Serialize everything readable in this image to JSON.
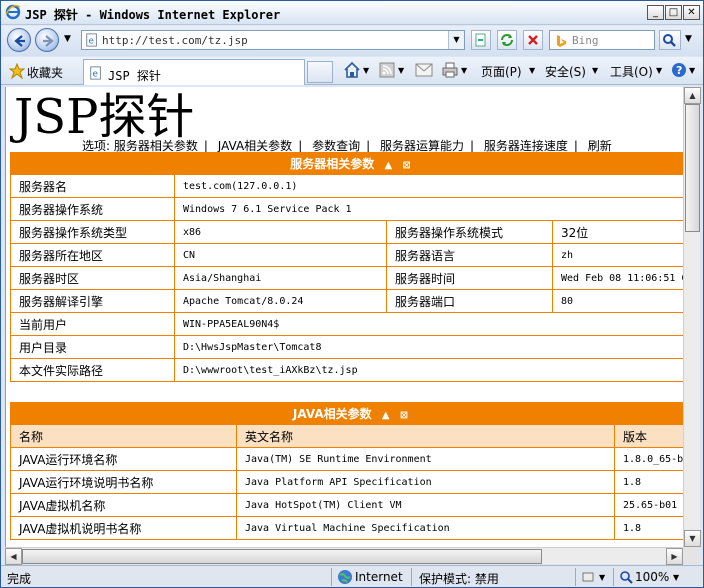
{
  "window": {
    "title": "JSP 探针 - Windows Internet Explorer",
    "minimize": "_",
    "maximize": "□",
    "close": "✕"
  },
  "nav": {
    "address": "http://test.com/tz.jsp",
    "search_placeholder": "Bing"
  },
  "favbar": {
    "favorites": "收藏夹",
    "tab_title": "JSP 探针",
    "page_menu": "页面(P)",
    "safety_menu": "安全(S)",
    "tools_menu": "工具(O)"
  },
  "page": {
    "title": "JSP探针",
    "options_label": "选项:",
    "options": [
      "服务器相关参数",
      "JAVA相关参数",
      "参数查询",
      "服务器运算能力",
      "服务器连接速度",
      "刷新"
    ],
    "server_section": {
      "header": "服务器相关参数",
      "rows": [
        {
          "k1": "服务器名",
          "v1": "test.com(127.0.0.1)"
        },
        {
          "k1": "服务器操作系统",
          "v1": "Windows 7 6.1 Service Pack 1"
        },
        {
          "k1": "服务器操作系统类型",
          "v1": "x86",
          "k2": "服务器操作系统模式",
          "v2": "32位"
        },
        {
          "k1": "服务器所在地区",
          "v1": "CN",
          "k2": "服务器语言",
          "v2": "zh"
        },
        {
          "k1": "服务器时区",
          "v1": "Asia/Shanghai",
          "k2": "服务器时间",
          "v2": "Wed Feb 08 11:06:51 C"
        },
        {
          "k1": "服务器解译引擎",
          "v1": "Apache Tomcat/8.0.24",
          "k2": "服务器端口",
          "v2": "80"
        },
        {
          "k1": "当前用户",
          "v1": "WIN-PPA5EAL90N4$"
        },
        {
          "k1": "用户目录",
          "v1": "D:\\HwsJspMaster\\Tomcat8"
        },
        {
          "k1": "本文件实际路径",
          "v1": "D:\\wwwroot\\test_iAXkBz\\tz.jsp"
        }
      ]
    },
    "java_section": {
      "header": "JAVA相关参数",
      "columns": [
        "名称",
        "英文名称",
        "版本"
      ],
      "rows": [
        {
          "name": "JAVA运行环境名称",
          "en": "Java(TM) SE Runtime Environment",
          "ver": "1.8.0_65-b1"
        },
        {
          "name": "JAVA运行环境说明书名称",
          "en": "Java Platform API Specification",
          "ver": "1.8"
        },
        {
          "name": "JAVA虚拟机名称",
          "en": "Java HotSpot(TM) Client VM",
          "ver": "25.65-b01"
        },
        {
          "name": "JAVA虚拟机说明书名称",
          "en": "Java Virtual Machine Specification",
          "ver": "1.8"
        }
      ]
    }
  },
  "status": {
    "left": "完成",
    "zone": "Internet",
    "protected": "保护模式: 禁用",
    "zoom": "100%"
  },
  "colors": {
    "accent": "#f08000",
    "column_header_bg": "#fbe0c2"
  }
}
